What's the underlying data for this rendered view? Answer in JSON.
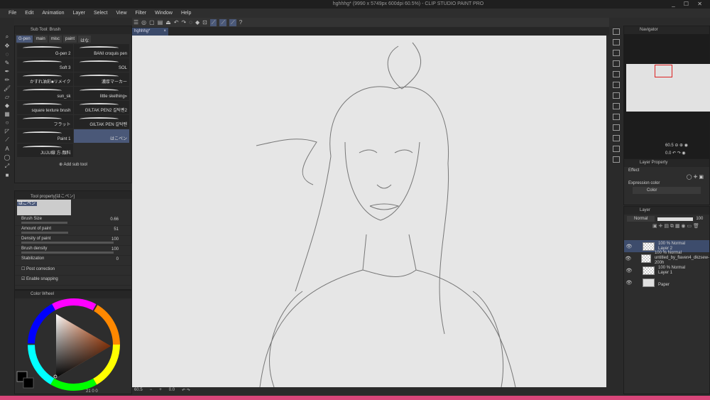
{
  "window": {
    "title": "hghhhg* (9990 x 5749px 600dpi 60.5%)  - CLIP STUDIO PAINT PRO",
    "controls": "_ ☐ ✕"
  },
  "menu": [
    "File",
    "Edit",
    "Animation",
    "Layer",
    "Select",
    "View",
    "Filter",
    "Window",
    "Help"
  ],
  "document_tab": {
    "name": "hghhhg*",
    "close": "×"
  },
  "subtool": {
    "title": "Sub Tool: Brush",
    "groups": [
      "G-pen",
      "main",
      "misc",
      "paint",
      "はな"
    ],
    "brushes": [
      {
        "name": "G-pen 2"
      },
      {
        "name": "BANI croquis pen"
      },
      {
        "name": "Soft 3"
      },
      {
        "name": "SOL"
      },
      {
        "name": "かすれ油彩■リメイク"
      },
      {
        "name": "濃厚マーカー"
      },
      {
        "name": "sun_sk"
      },
      {
        "name": "little skething»"
      },
      {
        "name": "square texture brush"
      },
      {
        "name": "GILTAK PEN2 길탁펜2"
      },
      {
        "name": "フラット"
      },
      {
        "name": "GILTAK PEN 길탁펜"
      },
      {
        "name": "Paint 1"
      },
      {
        "name": "はこペン",
        "active": true
      },
      {
        "name": "JUJU線 方·顔料"
      }
    ],
    "add_label": "Add sub tool"
  },
  "tool_property": {
    "title": "Tool property[はこペン]",
    "preview_label": "はこペン",
    "rows": [
      {
        "label": "Brush Size",
        "value": "0.66",
        "fill": 0.5
      },
      {
        "label": "Amount of paint",
        "value": "51",
        "fill": 0.51
      },
      {
        "label": "Density of paint",
        "value": "100",
        "fill": 1
      },
      {
        "label": "Brush density",
        "value": "100",
        "fill": 1
      },
      {
        "label": "Stabilization",
        "value": "0",
        "fill": 0
      }
    ],
    "post_correction": "Post correction",
    "enable_snapping": "Enable snapping",
    "snapping_checked": true
  },
  "color_wheel": {
    "title": "Color Wheel",
    "main_color": "#000000",
    "sub_color": "#000000",
    "readout": "21  0  0"
  },
  "status": {
    "zoom": "60.5",
    "angle": "0.0"
  },
  "navigator": {
    "title": "Navigator",
    "zoom": "60.5",
    "angle": "0.0"
  },
  "layer_property": {
    "title": "Layer Property",
    "effect_label": "Effect",
    "expression_label": "Expression color",
    "expression_value": "Color"
  },
  "layer_panel": {
    "title": "Layer",
    "blend_mode": "Normal",
    "opacity": "100",
    "layers": [
      {
        "mode": "100 % Normal",
        "name": "Layer 2",
        "active": true
      },
      {
        "mode": "100 % Normal",
        "name": "untitled_by_flaven4_dkzsew-200h"
      },
      {
        "mode": "100 % Normal",
        "name": "Layer 1"
      },
      {
        "mode": "",
        "name": "Paper"
      }
    ]
  },
  "colors": {
    "accent": "#4a5878",
    "canvas": "#e6e6e6",
    "bottom_bar": "#d9467a"
  }
}
